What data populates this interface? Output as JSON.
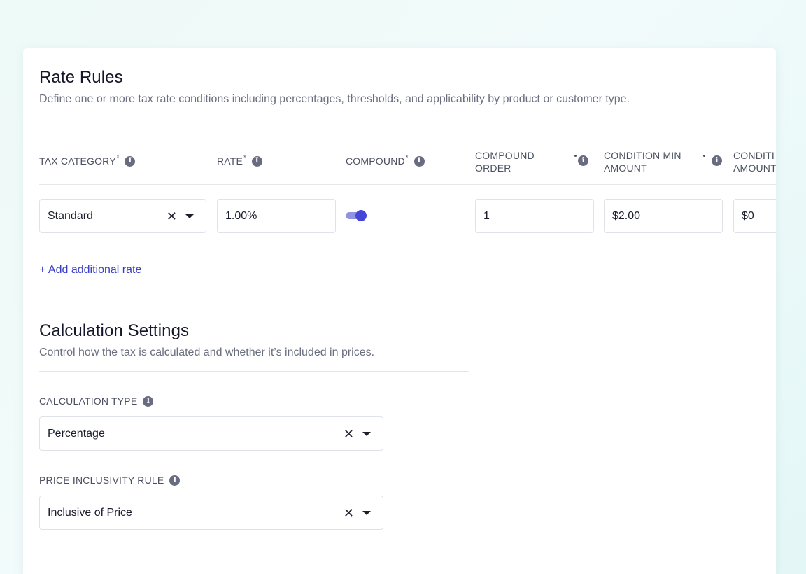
{
  "rate_rules": {
    "title": "Rate Rules",
    "description": "Define one or more tax rate conditions including percentages, thresholds, and applicability by product or customer type.",
    "columns": {
      "tax_category": "TAX CATEGORY",
      "rate": "RATE",
      "compound": "COMPOUND",
      "compound_order_1": "COMPOUND",
      "compound_order_2": "ORDER",
      "condition_min_1": "CONDITION MIN",
      "condition_min_2": "AMOUNT",
      "condition_max_1": "CONDITI",
      "condition_max_2": "AMOUNT"
    },
    "required_mark": "*",
    "row": {
      "tax_category": "Standard",
      "rate": "1.00%",
      "compound_enabled": true,
      "compound_order": "1",
      "condition_min_amount": "$2.00",
      "condition_max_amount": "$0"
    },
    "add_rate_label": "+ Add additional rate"
  },
  "calculation_settings": {
    "title": "Calculation Settings",
    "description": "Control how the tax is calculated and whether it’s included in prices.",
    "calculation_type_label": "CALCULATION TYPE",
    "calculation_type_value": "Percentage",
    "price_inclusivity_label": "PRICE INCLUSIVITY RULE",
    "price_inclusivity_value": "Inclusive of Price"
  },
  "icons": {
    "info": "info-icon",
    "clear": "close-icon",
    "dropdown": "caret-down-icon"
  },
  "colors": {
    "accent": "#3a3ec4",
    "toggle_on": "#4346d8",
    "info_icon": "#686c80"
  }
}
